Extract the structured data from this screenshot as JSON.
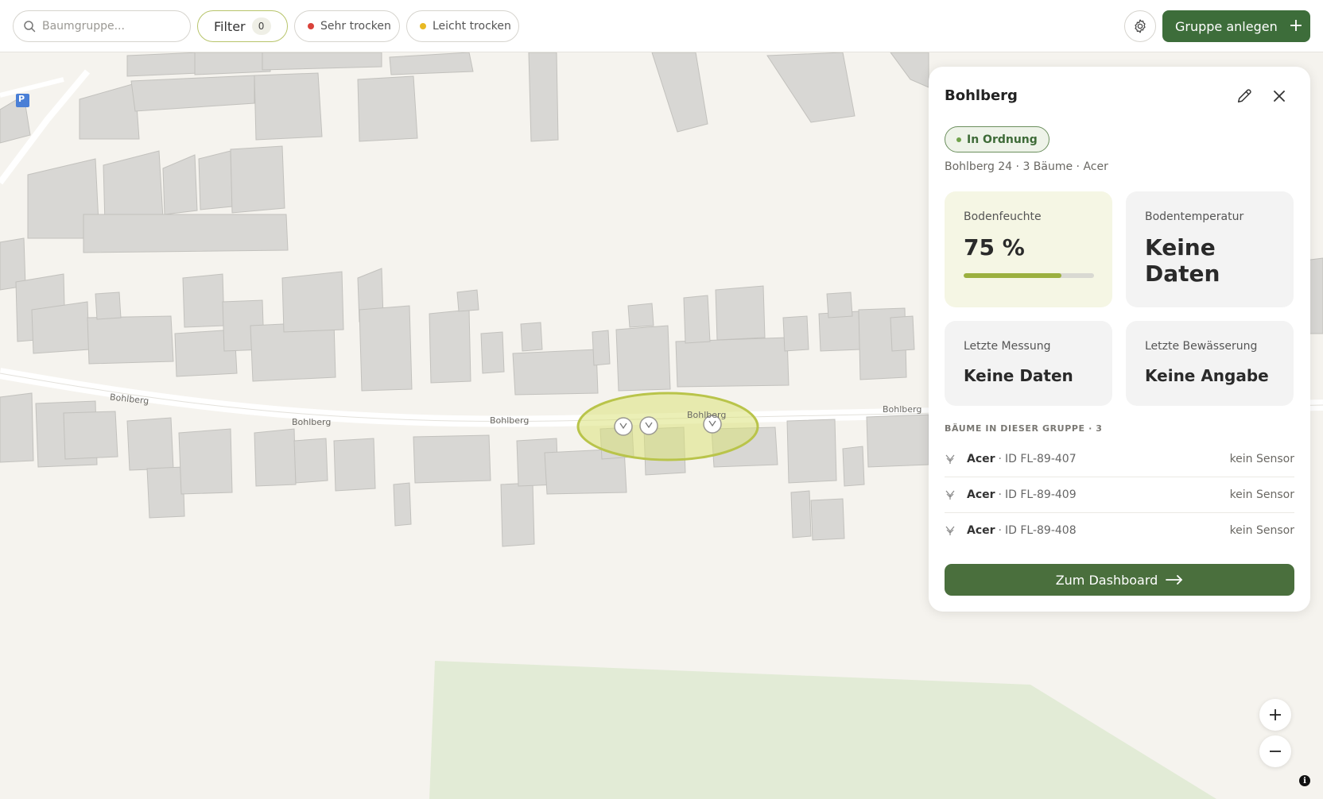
{
  "search": {
    "placeholder": "Baumgruppe..."
  },
  "filters": {
    "filter_label": "Filter",
    "filter_count": "0",
    "very_dry_label": "Sehr trocken",
    "slightly_dry_label": "Leicht trocken",
    "very_dry_color": "#d9423a",
    "slightly_dry_color": "#e8b923"
  },
  "header": {
    "add_group_label": "Gruppe anlegen"
  },
  "map": {
    "street_labels": [
      "Bohlberg",
      "Bohlberg",
      "Bohlberg",
      "Bohlberg",
      "Bohlberg"
    ],
    "parking_label": "P",
    "group_color": "#b9c44a",
    "green_area_color": "#e2ebd6"
  },
  "panel": {
    "title": "Bohlberg",
    "status": "In Ordnung",
    "meta": "Bohlberg 24 · 3 Bäume · Acer",
    "soil_moisture": {
      "label": "Bodenfeuchte",
      "value": "75 %",
      "level_percent": 75
    },
    "soil_temperature": {
      "label": "Bodentemperatur",
      "value": "Keine Daten"
    },
    "last_measurement": {
      "label": "Letzte Messung",
      "value": "Keine Daten"
    },
    "last_watering": {
      "label": "Letzte Bewässerung",
      "value": "Keine Angabe"
    },
    "trees_heading": "BÄUME IN DIESER GRUPPE · 3",
    "trees": [
      {
        "name": "Acer",
        "id": "ID FL-89-407",
        "sensor": "kein Sensor"
      },
      {
        "name": "Acer",
        "id": "ID FL-89-409",
        "sensor": "kein Sensor"
      },
      {
        "name": "Acer",
        "id": "ID FL-89-408",
        "sensor": "kein Sensor"
      }
    ],
    "dashboard_label": "Zum Dashboard"
  },
  "zoom": {
    "in": "+",
    "out": "−"
  },
  "attribution": {
    "icon": "i"
  }
}
